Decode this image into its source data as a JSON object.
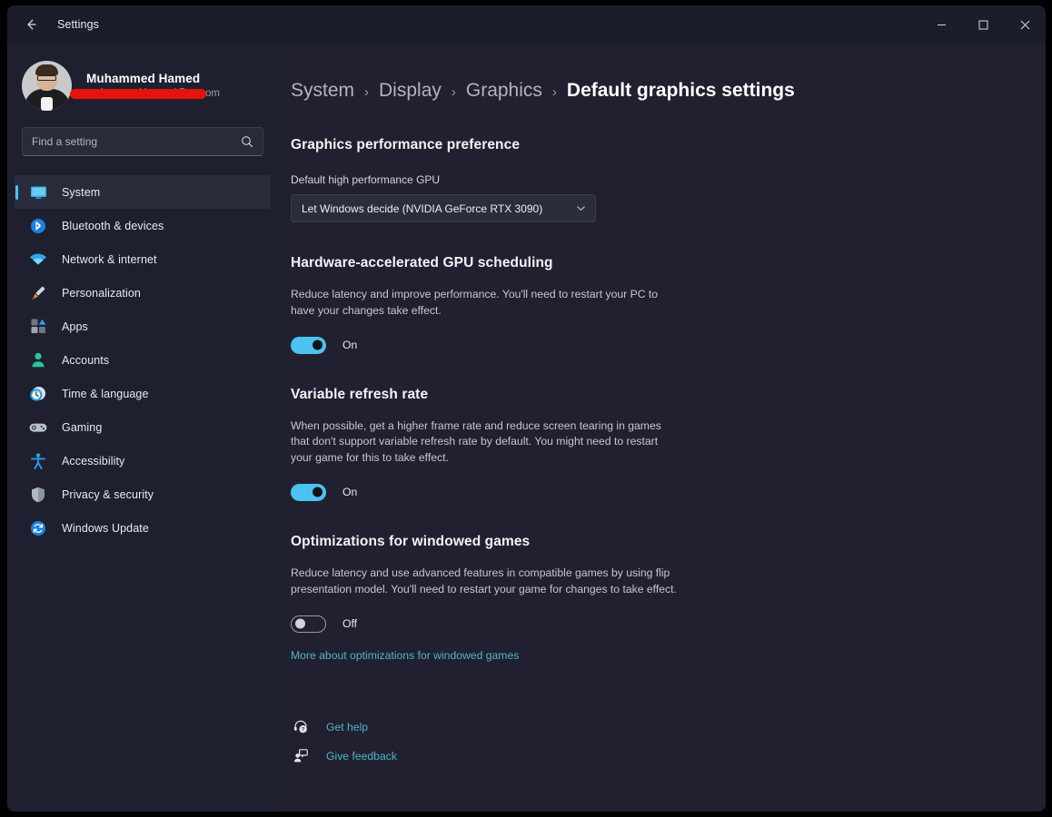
{
  "window": {
    "title": "Settings",
    "back_icon": "arrow-left-icon",
    "controls": {
      "minimize": "minimize-icon",
      "maximize": "maximize-icon",
      "close": "close-icon"
    }
  },
  "sidebar": {
    "profile": {
      "name": "Muhammed Hamed",
      "email": "muhammed.hamed@ey.com",
      "email_redacted": true,
      "avatar": "user-avatar"
    },
    "search": {
      "placeholder": "Find a setting",
      "value": "",
      "icon": "search-icon"
    },
    "items": [
      {
        "label": "System",
        "icon": "monitor-icon",
        "selected": true
      },
      {
        "label": "Bluetooth & devices",
        "icon": "bluetooth-icon",
        "selected": false
      },
      {
        "label": "Network & internet",
        "icon": "wifi-icon",
        "selected": false
      },
      {
        "label": "Personalization",
        "icon": "paintbrush-icon",
        "selected": false
      },
      {
        "label": "Apps",
        "icon": "apps-grid-icon",
        "selected": false
      },
      {
        "label": "Accounts",
        "icon": "person-icon",
        "selected": false
      },
      {
        "label": "Time & language",
        "icon": "clock-globe-icon",
        "selected": false
      },
      {
        "label": "Gaming",
        "icon": "gamepad-icon",
        "selected": false
      },
      {
        "label": "Accessibility",
        "icon": "accessibility-icon",
        "selected": false
      },
      {
        "label": "Privacy & security",
        "icon": "shield-icon",
        "selected": false
      },
      {
        "label": "Windows Update",
        "icon": "update-refresh-icon",
        "selected": false
      }
    ]
  },
  "breadcrumb": {
    "separator": "›",
    "items": [
      {
        "label": "System",
        "current": false
      },
      {
        "label": "Display",
        "current": false
      },
      {
        "label": "Graphics",
        "current": false
      },
      {
        "label": "Default graphics settings",
        "current": true
      }
    ]
  },
  "main": {
    "performance": {
      "title": "Graphics performance preference",
      "gpu_label": "Default high performance GPU",
      "gpu_selected": "Let Windows decide (NVIDIA GeForce RTX 3090)",
      "chevron_icon": "chevron-down-icon"
    },
    "gpu_scheduling": {
      "title": "Hardware-accelerated GPU scheduling",
      "description": "Reduce latency and improve performance. You'll need to restart your PC to have your changes take effect.",
      "toggle_state": "On",
      "toggle_on": true
    },
    "variable_refresh": {
      "title": "Variable refresh rate",
      "description": "When possible, get a higher frame rate and reduce screen tearing in games that don't support variable refresh rate by default. You might need to restart your game for this to take effect.",
      "toggle_state": "On",
      "toggle_on": true
    },
    "windowed_games": {
      "title": "Optimizations for windowed games",
      "description": "Reduce latency and use advanced features in compatible games by using flip presentation model. You'll need to restart your game for changes to take effect.",
      "toggle_state": "Off",
      "toggle_on": false,
      "link": "More about optimizations for windowed games"
    },
    "footer": {
      "get_help": {
        "label": "Get help",
        "icon": "help-headset-icon"
      },
      "give_feedback": {
        "label": "Give feedback",
        "icon": "feedback-person-icon"
      }
    }
  },
  "colors": {
    "accent": "#4cc2f1",
    "link": "#52b4c4",
    "window_bg": "#202030",
    "sidebar_bg": "#1e2030",
    "titlebar_bg": "#1b1d2a",
    "redaction": "#e8120c"
  }
}
